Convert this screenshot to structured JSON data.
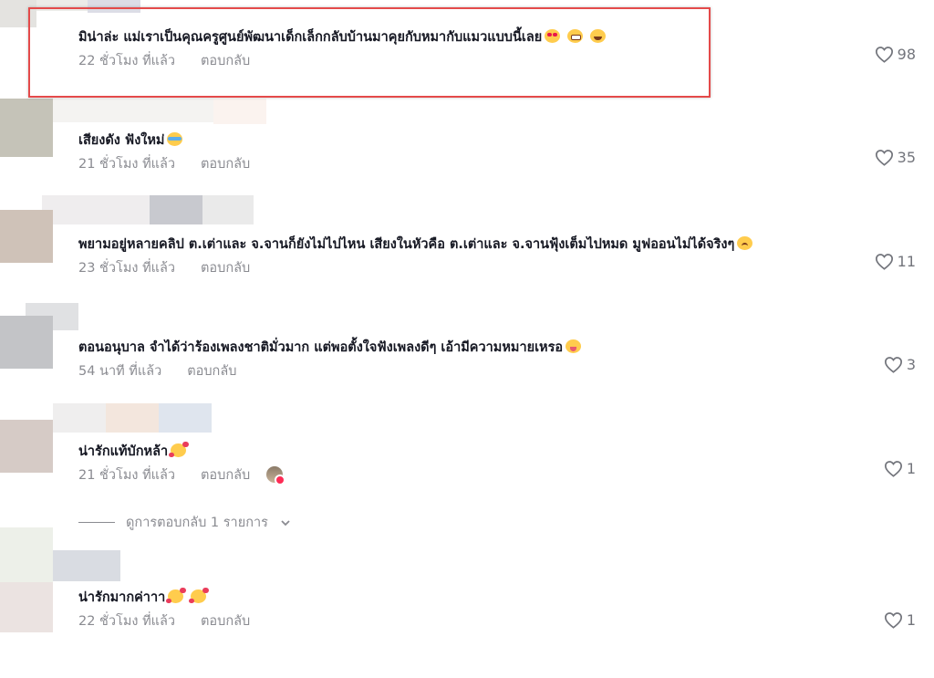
{
  "comments": [
    {
      "text": "มิน่าล่ะ แม่เราเป็นคุณครูศูนย์พัฒนาเด็กเล็กกลับบ้านมาคุยกับหมากับแมวแบบนี้เลย",
      "emojis": [
        "heart-eyes-emoji",
        "grinning-emoji",
        "laughing-emoji"
      ],
      "time": "22 ชั่วโมง ที่แล้ว",
      "reply": "ตอบกลับ",
      "likes": "98",
      "highlighted": true
    },
    {
      "text": "เสียงดัง ฟังใหม่",
      "emojis": [
        "laughing-tears-emoji"
      ],
      "time": "21 ชั่วโมง ที่แล้ว",
      "reply": "ตอบกลับ",
      "likes": "35"
    },
    {
      "text": "พยามอยู่หลายคลิป ต.เต่าและ จ.จานก็ยังไม่ไปไหน เสียงในหัวคือ ต.เต่าและ จ.จานฟุ้งเต็มไปหมด มูฟออนไม่ได้จริงๆ",
      "emojis": [
        "sad-face-emoji"
      ],
      "time": "23 ชั่วโมง ที่แล้ว",
      "reply": "ตอบกลับ",
      "likes": "11"
    },
    {
      "text": "ตอนอนุบาล จำได้ว่าร้องเพลงชาติมั่วมาก แต่พอตั้งใจฟังเพลงดีๆ เอ้ามีความหมายเหรอ",
      "emojis": [
        "tongue-out-emoji"
      ],
      "time": "54 นาที ที่แล้ว",
      "reply": "ตอบกลับ",
      "likes": "3"
    },
    {
      "text": "น่ารักแท้บักหล้า",
      "emojis": [
        "smiling-hearts-emoji"
      ],
      "time": "21 ชั่วโมง ที่แล้ว",
      "reply": "ตอบกลับ",
      "likes": "1",
      "creator_liked": true
    },
    {
      "text": "น่ารักมากค่าาา",
      "emojis": [
        "smiling-hearts-emoji",
        "smiling-hearts-emoji"
      ],
      "time": "22 ชั่วโมง ที่แล้ว",
      "reply": "ตอบกลับ",
      "likes": "1"
    }
  ],
  "view_replies": {
    "label": "ดูการตอบกลับ 1 รายการ",
    "icon": "chevron-down-icon"
  },
  "colors": {
    "highlight_border": "#e44a4a",
    "meta_text": "#8a8b91",
    "comment_text": "#161823",
    "like_icon": "#73757c"
  }
}
